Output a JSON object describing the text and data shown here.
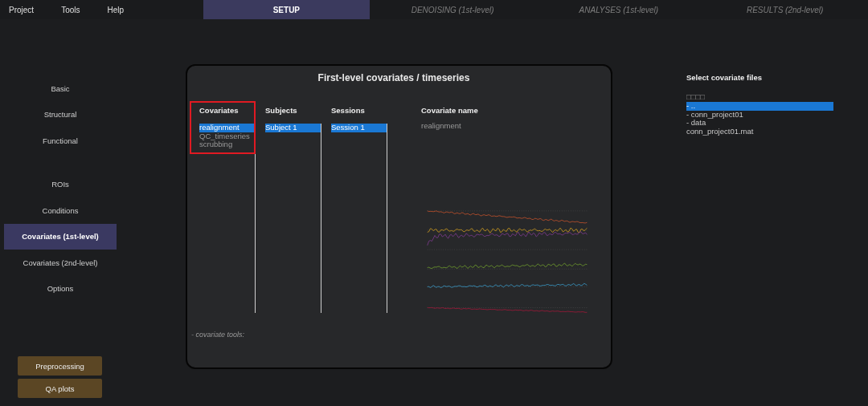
{
  "menu": [
    "Project",
    "Tools",
    "Help"
  ],
  "tabs": [
    {
      "label": "SETUP",
      "selected": true
    },
    {
      "label": "DENOISING (1st-level)",
      "selected": false
    },
    {
      "label": "ANALYSES (1st-level)",
      "selected": false
    },
    {
      "label": "RESULTS (2nd-level)",
      "selected": false
    }
  ],
  "sidebar": {
    "groups": [
      {
        "items": [
          {
            "label": "Basic",
            "selected": false
          },
          {
            "label": "Structural",
            "selected": false
          },
          {
            "label": "Functional",
            "selected": false
          }
        ]
      },
      {
        "items": [
          {
            "label": "ROIs",
            "selected": false
          },
          {
            "label": "Conditions",
            "selected": false
          },
          {
            "label": "Covariates (1st-level)",
            "selected": true
          },
          {
            "label": "Covariates (2nd-level)",
            "selected": false
          },
          {
            "label": "Options",
            "selected": false
          }
        ]
      }
    ],
    "buttons": [
      "Preprocessing",
      "QA plots"
    ]
  },
  "panel": {
    "title": "First-level covariates / timeseries",
    "lists": [
      {
        "heading": "Covariates",
        "highlighted": true,
        "items": [
          {
            "label": "realignment",
            "selected": true
          },
          {
            "label": "QC_timeseries",
            "selected": false
          },
          {
            "label": "scrubbing",
            "selected": false
          }
        ]
      },
      {
        "heading": "Subjects",
        "highlighted": false,
        "items": [
          {
            "label": "Subject 1",
            "selected": true
          }
        ]
      },
      {
        "heading": "Sessions",
        "highlighted": false,
        "items": [
          {
            "label": "Session 1",
            "selected": true
          }
        ]
      }
    ],
    "covariate_name": {
      "heading": "Covariate name",
      "value": "realignment"
    },
    "footnote": "- covariate tools:"
  },
  "files": {
    "title": "Select covariate files",
    "filter": "□□□□",
    "items": [
      {
        "label": "- ..",
        "selected": true
      },
      {
        "label": "- conn_project01",
        "selected": false
      },
      {
        "label": "- data",
        "selected": false
      },
      {
        "label": "conn_project01.mat",
        "selected": false
      }
    ]
  }
}
